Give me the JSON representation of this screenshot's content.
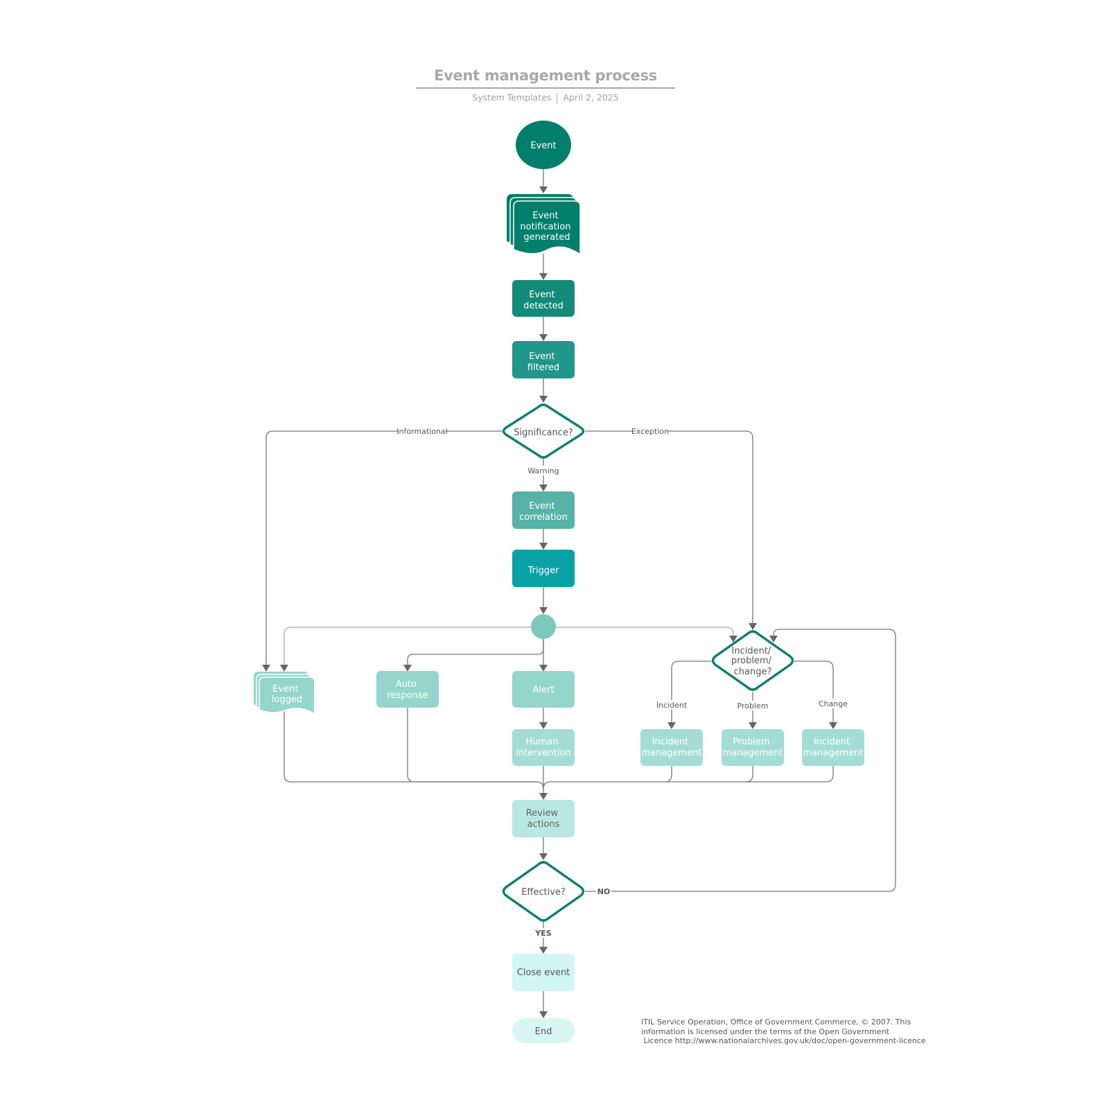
{
  "header": {
    "title": "Event management process",
    "source": "System Templates",
    "date": "April 2, 2025"
  },
  "colors": {
    "dark_teal": "#017f6c",
    "teal_1": "#148a79",
    "teal_2": "#21968a",
    "teal_correlation": "#57b3a7",
    "trigger": "#09a2a4",
    "junction": "#7cc8bc",
    "light_teal": "#94d6cc",
    "lighter_teal": "#a4ddd5",
    "review": "#b9e7e1",
    "close": "#d2f6f1",
    "end": "#d8f7f3",
    "diamond_stroke": "#0d8070",
    "edge": "#666666"
  },
  "nodes": {
    "event": "Event",
    "notification": [
      "Event",
      "notification",
      "generated"
    ],
    "detected": [
      "Event",
      "detected"
    ],
    "filtered": [
      "Event",
      "filtered"
    ],
    "significance": "Significance?",
    "correlation": [
      "Event",
      "correlation"
    ],
    "trigger": "Trigger",
    "logged": [
      "Event",
      "logged"
    ],
    "auto_response": [
      "Auto",
      "response"
    ],
    "alert": "Alert",
    "human": [
      "Human",
      "intervention"
    ],
    "ipc": [
      "Incident/",
      "problem/",
      "change?"
    ],
    "incident_mgmt_1": [
      "Incident",
      "management"
    ],
    "problem_mgmt": [
      "Problem",
      "management"
    ],
    "incident_mgmt_2": [
      "Incident",
      "management"
    ],
    "review": [
      "Review",
      "actions"
    ],
    "effective": "Effective?",
    "close": "Close event",
    "end": "End"
  },
  "edge_labels": {
    "informational": "Informational",
    "exception": "Exception",
    "warning": "Warning",
    "incident": "Incident",
    "problem": "Problem",
    "change": "Change",
    "no": "NO",
    "yes": "YES"
  },
  "footer": {
    "line1": "ITIL Service Operation, Office of Government Commerce, © 2007. This",
    "line2": "information is licensed under the terms of the Open Government",
    "line3": " Licence http://www.nationalarchives.gov.uk/doc/open-government-licence"
  }
}
